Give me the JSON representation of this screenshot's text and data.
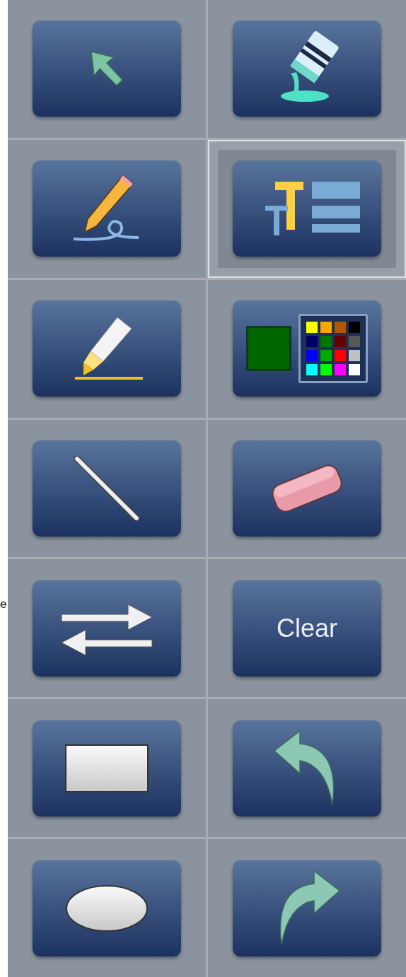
{
  "edge_text": "e",
  "tools": [
    {
      "kind": "select",
      "selected": false
    },
    {
      "kind": "fill",
      "selected": false
    },
    {
      "kind": "pen",
      "selected": false
    },
    {
      "kind": "text",
      "selected": true
    },
    {
      "kind": "highlighter",
      "selected": false
    },
    {
      "kind": "color",
      "selected": false,
      "current": {
        "color": "#006600"
      },
      "palette": [
        {
          "color": "#ffff00"
        },
        {
          "color": "#ffa500"
        },
        {
          "color": "#b05a00"
        },
        {
          "color": "#000000"
        },
        {
          "color": "#000066"
        },
        {
          "color": "#007700"
        },
        {
          "color": "#660000"
        },
        {
          "color": "#555a55"
        },
        {
          "color": "#0000ff"
        },
        {
          "color": "#00aa00"
        },
        {
          "color": "#ff0000"
        },
        {
          "color": "#c0c0c0"
        },
        {
          "color": "#00ffff"
        },
        {
          "color": "#00ff00"
        },
        {
          "color": "#ff00ff"
        },
        {
          "color": "#ffffff"
        }
      ]
    },
    {
      "kind": "line",
      "selected": false
    },
    {
      "kind": "eraser",
      "selected": false
    },
    {
      "kind": "swap",
      "selected": false
    },
    {
      "kind": "label",
      "selected": false,
      "label": "Clear"
    },
    {
      "kind": "rectangle",
      "selected": false
    },
    {
      "kind": "undo",
      "selected": false
    },
    {
      "kind": "ellipse",
      "selected": false
    },
    {
      "kind": "redo",
      "selected": false
    }
  ]
}
